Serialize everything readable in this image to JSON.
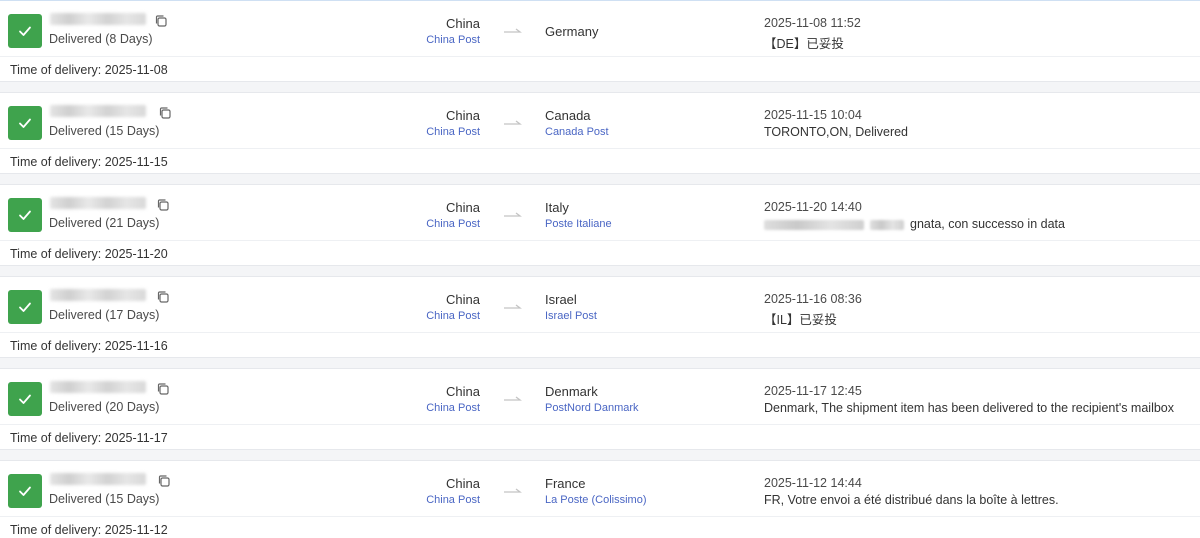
{
  "colors": {
    "delivered_green": "#3fa34d",
    "carrier_link": "#4a66c4"
  },
  "icons": {
    "status": "check-icon",
    "copy": "copy-icon",
    "route": "arrow-right-icon"
  },
  "shipments": [
    {
      "status": "Delivered (8 Days)",
      "origin_country": "China",
      "origin_carrier": "China Post",
      "dest_country": "Germany",
      "dest_carrier": "",
      "event_time": "2025-11-08 11:52",
      "event_desc": "【DE】已妥投",
      "delivery_time": "Time of delivery: 2025-11-08"
    },
    {
      "status": "Delivered (15 Days)",
      "origin_country": "China",
      "origin_carrier": "China Post",
      "dest_country": "Canada",
      "dest_carrier": "Canada Post",
      "event_time": "2025-11-15 10:04",
      "event_desc": "TORONTO,ON, Delivered",
      "delivery_time": "Time of delivery: 2025-11-15"
    },
    {
      "status": "Delivered (21 Days)",
      "origin_country": "China",
      "origin_carrier": "China Post",
      "dest_country": "Italy",
      "dest_carrier": "Poste Italiane",
      "event_time": "2025-11-20 14:40",
      "event_desc": "gnata, con successo in data",
      "delivery_time": "Time of delivery: 2025-11-20"
    },
    {
      "status": "Delivered (17 Days)",
      "origin_country": "China",
      "origin_carrier": "China Post",
      "dest_country": "Israel",
      "dest_carrier": "Israel Post",
      "event_time": "2025-11-16 08:36",
      "event_desc": "【IL】已妥投",
      "delivery_time": "Time of delivery: 2025-11-16"
    },
    {
      "status": "Delivered (20 Days)",
      "origin_country": "China",
      "origin_carrier": "China Post",
      "dest_country": "Denmark",
      "dest_carrier": "PostNord Danmark",
      "event_time": "2025-11-17 12:45",
      "event_desc": "Denmark, The shipment item has been delivered to the recipient's mailbox",
      "delivery_time": "Time of delivery: 2025-11-17"
    },
    {
      "status": "Delivered (15 Days)",
      "origin_country": "China",
      "origin_carrier": "China Post",
      "dest_country": "France",
      "dest_carrier": "La Poste (Colissimo)",
      "event_time": "2025-11-12 14:44",
      "event_desc": "FR, Votre envoi a été distribué dans la boîte à lettres.",
      "delivery_time": "Time of delivery: 2025-11-12"
    }
  ]
}
